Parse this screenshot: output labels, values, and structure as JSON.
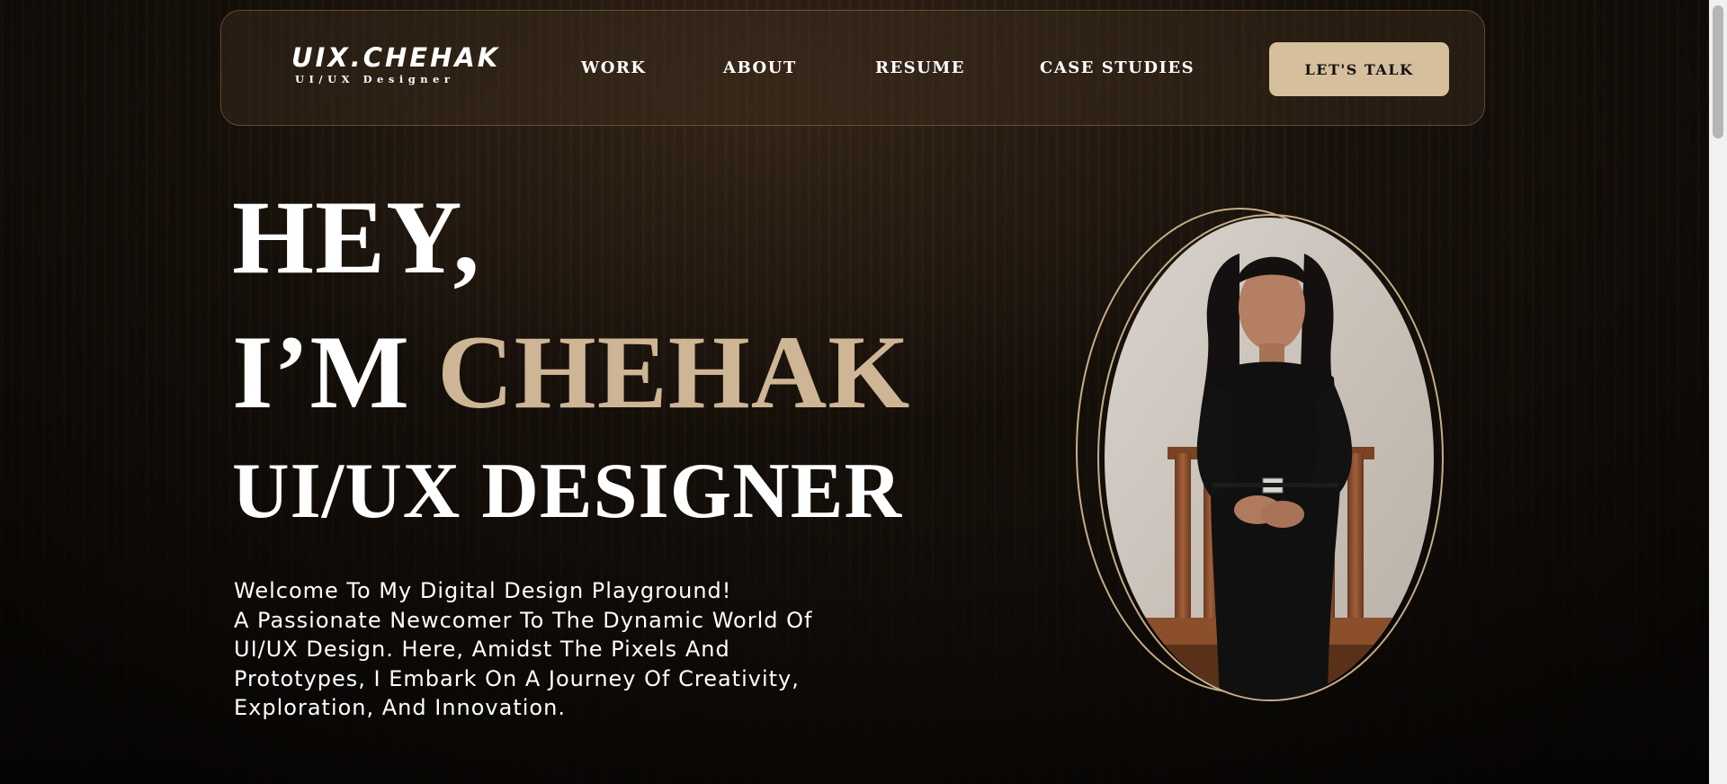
{
  "nav": {
    "logo_title": "UIX.CHEHAK",
    "logo_subtitle": "UI/UX Designer",
    "links": [
      "WORK",
      "ABOUT",
      "RESUME",
      "CASE STUDIES"
    ],
    "cta_label": "LET'S TALK"
  },
  "hero": {
    "line1": "HEY,",
    "line2_prefix": "I’M ",
    "name": "CHEHAK",
    "role": "UI/UX DESIGNER",
    "intro_lines": [
      "Welcome To My Digital Design Playground!",
      "A Passionate Newcomer To The Dynamic World Of",
      "UI/UX Design. Here, Amidst The Pixels And",
      "Prototypes, I Embark On A Journey Of Creativity,",
      "Exploration, And Innovation."
    ]
  },
  "colors": {
    "accent": "#cdb595",
    "button_bg": "#d6bf9d",
    "background": "#150f0a",
    "ring": "#c7ad88"
  }
}
